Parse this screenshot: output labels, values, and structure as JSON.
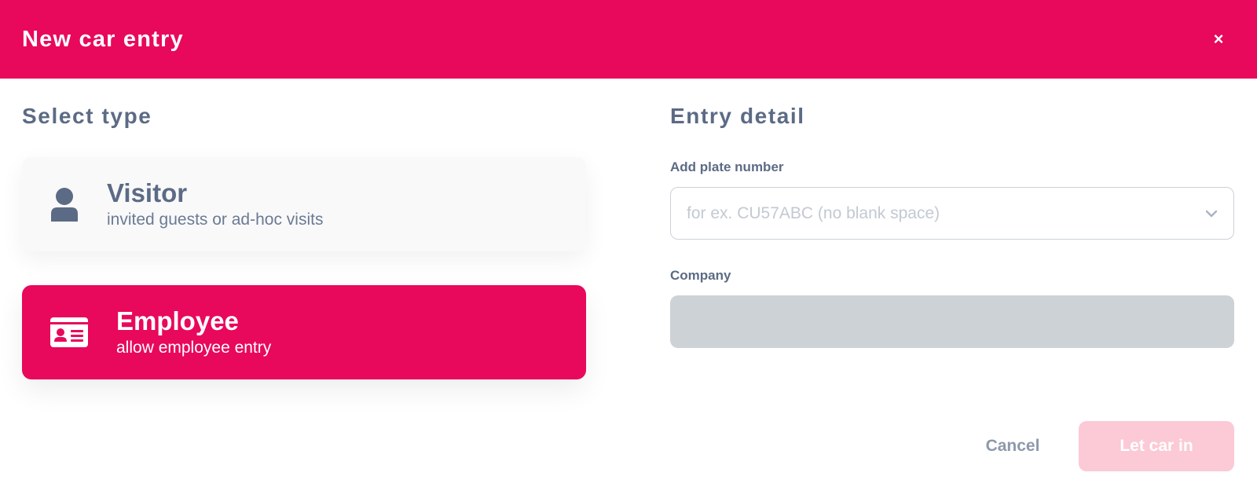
{
  "header": {
    "title": "New car entry",
    "close_icon": "close-icon",
    "close_glyph": "×"
  },
  "select_type": {
    "title": "Select type",
    "options": [
      {
        "id": "visitor",
        "icon": "person-icon",
        "title": "Visitor",
        "subtitle": "invited guests or ad-hoc visits",
        "selected": false
      },
      {
        "id": "employee",
        "icon": "id-card-icon",
        "title": "Employee",
        "subtitle": "allow employee entry",
        "selected": true
      }
    ]
  },
  "entry_detail": {
    "title": "Entry detail",
    "plate": {
      "label": "Add plate number",
      "placeholder": "for ex. CU57ABC (no blank space)",
      "value": "",
      "icon": "chevron-down-icon"
    },
    "company": {
      "label": "Company",
      "value": "",
      "disabled": true
    }
  },
  "actions": {
    "cancel_label": "Cancel",
    "submit_label": "Let car in",
    "submit_disabled": true
  },
  "colors": {
    "accent": "#e8085c",
    "text": "#5c6b85",
    "disabled_button": "#fbcad6",
    "disabled_field": "#cdd2d7"
  }
}
